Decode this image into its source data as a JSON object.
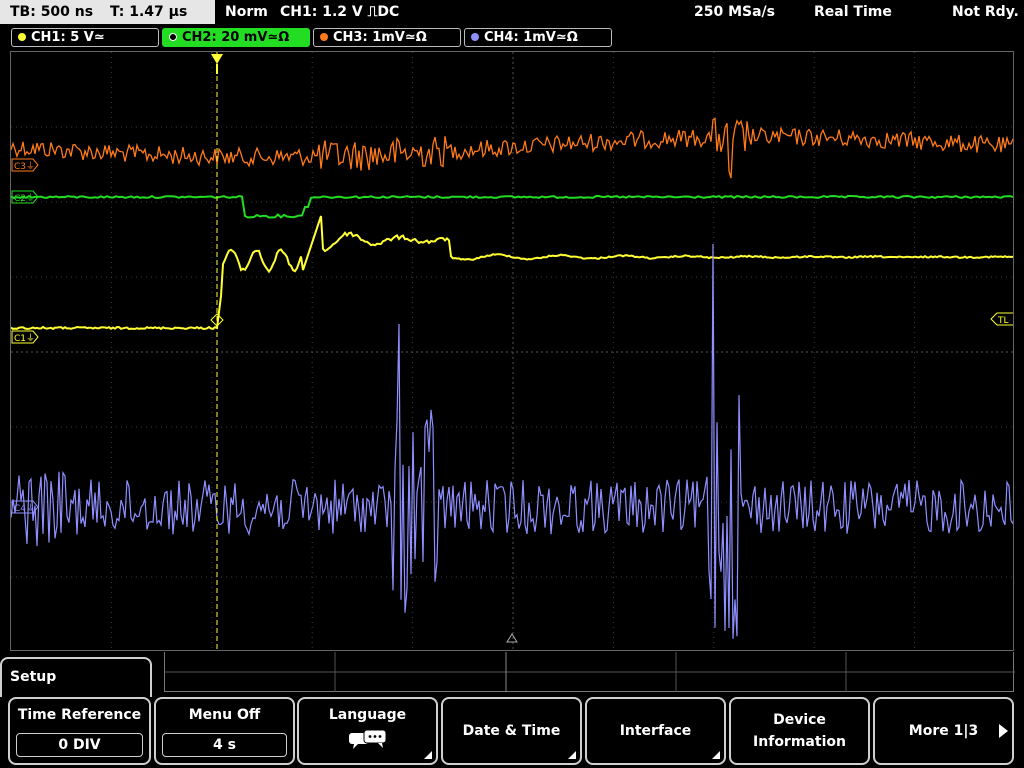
{
  "top_bar": {
    "timebase": "TB: 500 ns",
    "trigger_time": "T: 1.47 µs",
    "mode": "Norm",
    "trigger": "CH1: 1.2 V ⎍DC",
    "sample_rate": "250 MSa/s",
    "acq_mode": "Real Time",
    "status": "Not Rdy."
  },
  "channels": [
    {
      "label": "CH1: 5 V≃",
      "color": "#ffff33",
      "active": false
    },
    {
      "label": "CH2: 20 mV≃Ω",
      "color": "#22dd22",
      "active": true
    },
    {
      "label": "CH3: 1mV≃Ω",
      "color": "#ff7a1a",
      "active": false
    },
    {
      "label": "CH4: 1mV≃Ω",
      "color": "#8f8fff",
      "active": false
    }
  ],
  "markers": {
    "c3": "C3",
    "c2": "C2",
    "c1": "C1",
    "c4": "C4",
    "trigger_level": "TL"
  },
  "menu": {
    "title": "Setup",
    "softkeys": [
      {
        "label": "Time Reference",
        "value": "0 DIV"
      },
      {
        "label": "Menu Off",
        "value": "4 s"
      },
      {
        "label": "Language",
        "icon": "speech-bubbles-icon"
      },
      {
        "label": "Date & Time"
      },
      {
        "label": "Interface"
      },
      {
        "label": "Device Information",
        "line1": "Device",
        "line2": "Information"
      },
      {
        "label": "More 1|3"
      }
    ]
  },
  "colors": {
    "ch1": "#ffff33",
    "ch2": "#22dd22",
    "ch3": "#ff7a1a",
    "ch4": "#8f8fff",
    "grid": "#555555"
  }
}
